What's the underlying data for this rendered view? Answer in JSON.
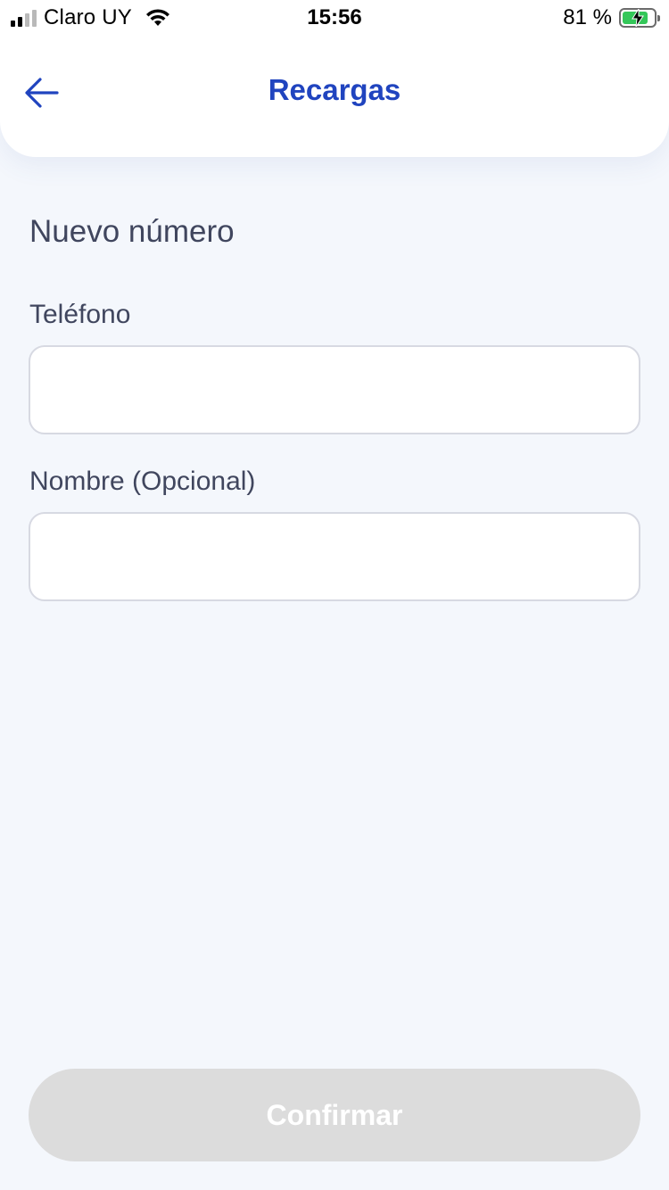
{
  "status_bar": {
    "carrier": "Claro UY",
    "time": "15:56",
    "battery_percent": "81 %",
    "battery_level": 0.81,
    "signal_bars": 2,
    "signal_bars_total": 4
  },
  "header": {
    "title": "Recargas",
    "back_icon": "arrow-left-icon"
  },
  "form": {
    "section_title": "Nuevo número",
    "phone_label": "Teléfono",
    "phone_value": "",
    "name_label": "Nombre (Opcional)",
    "name_value": ""
  },
  "actions": {
    "confirm_label": "Confirmar",
    "confirm_enabled": false
  },
  "colors": {
    "accent": "#2044bf",
    "background": "#f4f7fc",
    "text": "#40465e",
    "disabled_button": "#dcdcdc",
    "battery_fill": "#34c759"
  }
}
